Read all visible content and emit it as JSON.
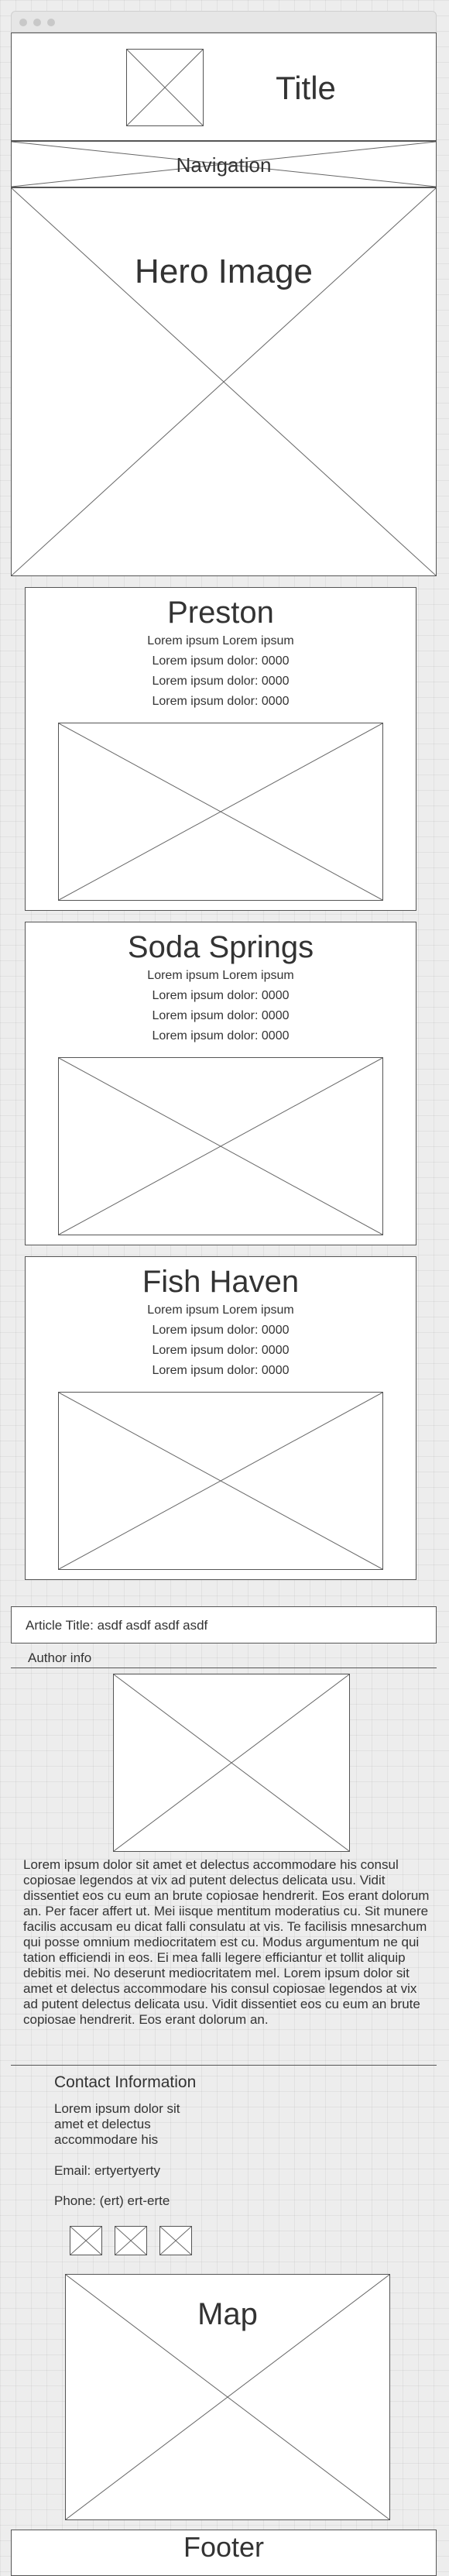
{
  "header": {
    "title": "Title"
  },
  "nav": {
    "label": "Navigation"
  },
  "hero": {
    "label": "Hero Image"
  },
  "cards": [
    {
      "title": "Preston",
      "subtitle": "Lorem ipsum Lorem ipsum",
      "rows": [
        "Lorem ipsum dolor:  0000",
        "Lorem ipsum dolor:  0000",
        "Lorem ipsum dolor:  0000"
      ]
    },
    {
      "title": "Soda Springs",
      "subtitle": "Lorem ipsum Lorem ipsum",
      "rows": [
        "Lorem ipsum dolor:  0000",
        "Lorem ipsum dolor:  0000",
        "Lorem ipsum dolor:  0000"
      ]
    },
    {
      "title": "Fish Haven",
      "subtitle": "Lorem ipsum Lorem ipsum",
      "rows": [
        "Lorem ipsum dolor:  0000",
        "Lorem ipsum dolor:  0000",
        "Lorem ipsum dolor:  0000"
      ]
    }
  ],
  "article": {
    "title": "Article Title: asdf asdf asdf asdf",
    "author": "Author info",
    "body": "Lorem ipsum dolor sit amet et delectus accommodare his consul copiosae legendos at vix ad putent delectus delicata usu. Vidit dissentiet eos cu eum an brute copiosae hendrerit. Eos erant dolorum an. Per facer affert ut. Mei iisque mentitum moderatius cu. Sit munere facilis accusam eu dicat falli consulatu at vis. Te facilisis mnesarchum qui posse omnium mediocritatem est cu. Modus argumentum ne qui tation efficiendi in eos. Ei mea falli legere efficiantur et tollit aliquip debitis mei. No deserunt mediocritatem mel. Lorem ipsum dolor sit amet et delectus accommodare his consul copiosae legendos at vix ad putent delectus delicata usu. Vidit dissentiet eos cu eum an brute copiosae hendrerit. Eos erant dolorum an."
  },
  "contact": {
    "heading": "Contact Information",
    "address": "Lorem ipsum dolor sit amet et delectus accommodare his",
    "email": "Email: ertyertyerty",
    "phone": "Phone: (ert) ert-erte"
  },
  "map": {
    "label": "Map"
  },
  "footer": {
    "label": "Footer"
  }
}
